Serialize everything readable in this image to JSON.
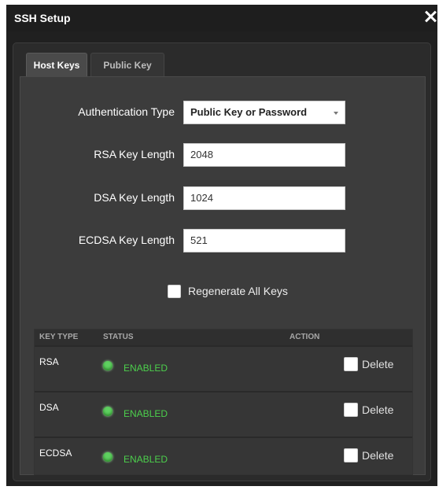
{
  "window": {
    "title": "SSH Setup"
  },
  "tabs": [
    {
      "label": "Host Keys",
      "active": true
    },
    {
      "label": "Public Key",
      "active": false
    }
  ],
  "form": {
    "auth_type": {
      "label": "Authentication Type",
      "value": "Public Key or Password"
    },
    "rsa": {
      "label": "RSA Key Length",
      "value": "2048"
    },
    "dsa": {
      "label": "DSA Key Length",
      "value": "1024"
    },
    "ecdsa": {
      "label": "ECDSA Key Length",
      "value": "521"
    },
    "regenerate": {
      "label": "Regenerate All Keys",
      "checked": false
    }
  },
  "table": {
    "headers": [
      "KEY TYPE",
      "STATUS",
      "ACTION"
    ],
    "rows": [
      {
        "key_type": "RSA",
        "status": "ENABLED",
        "action": "Delete"
      },
      {
        "key_type": "DSA",
        "status": "ENABLED",
        "action": "Delete"
      },
      {
        "key_type": "ECDSA",
        "status": "ENABLED",
        "action": "Delete"
      }
    ]
  },
  "colors": {
    "status_enabled": "#4ccf4c",
    "background": "#202020",
    "content_bg": "#3c3c3c"
  }
}
